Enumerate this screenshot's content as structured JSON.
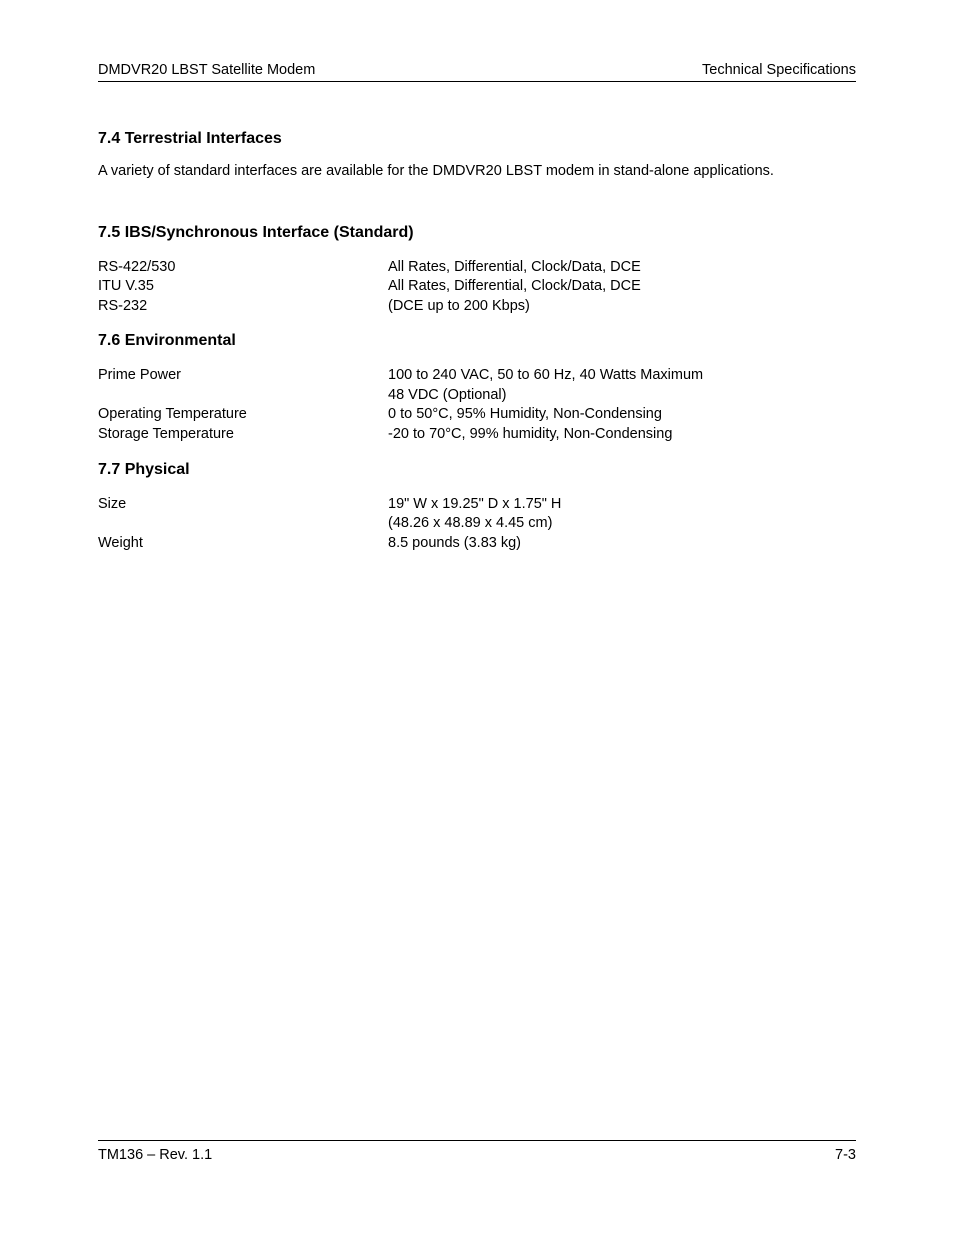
{
  "header": {
    "left": "DMDVR20 LBST Satellite Modem",
    "right": "Technical Specifications"
  },
  "sections": {
    "s74": {
      "heading": "7.4  Terrestrial Interfaces",
      "paragraph": "A variety of standard interfaces are available for the DMDVR20 LBST modem in stand-alone applications."
    },
    "s75": {
      "heading": "7.5  IBS/Synchronous Interface (Standard)",
      "rows": [
        {
          "label": "RS-422/530",
          "value": "All Rates, Differential, Clock/Data, DCE"
        },
        {
          "label": "ITU V.35",
          "value": "All Rates, Differential, Clock/Data, DCE"
        },
        {
          "label": "RS-232",
          "value": "(DCE up to 200 Kbps)"
        }
      ]
    },
    "s76": {
      "heading": "7.6  Environmental",
      "rows": [
        {
          "label": "Prime Power",
          "value": "100 to 240 VAC, 50 to 60 Hz, 40 Watts Maximum",
          "value2": "48 VDC (Optional)"
        },
        {
          "label": "Operating Temperature",
          "value": "0 to 50°C, 95% Humidity, Non-Condensing"
        },
        {
          "label": "Storage Temperature",
          "value": "-20 to 70°C, 99% humidity, Non-Condensing"
        }
      ]
    },
    "s77": {
      "heading": "7.7  Physical",
      "rows": [
        {
          "label": "Size",
          "value": "19\" W x 19.25\" D x 1.75\" H",
          "value2": "(48.26 x 48.89 x 4.45 cm)"
        },
        {
          "label": "Weight",
          "value": "8.5 pounds (3.83 kg)"
        }
      ]
    }
  },
  "footer": {
    "left": "TM136 – Rev. 1.1",
    "right": "7-3"
  }
}
